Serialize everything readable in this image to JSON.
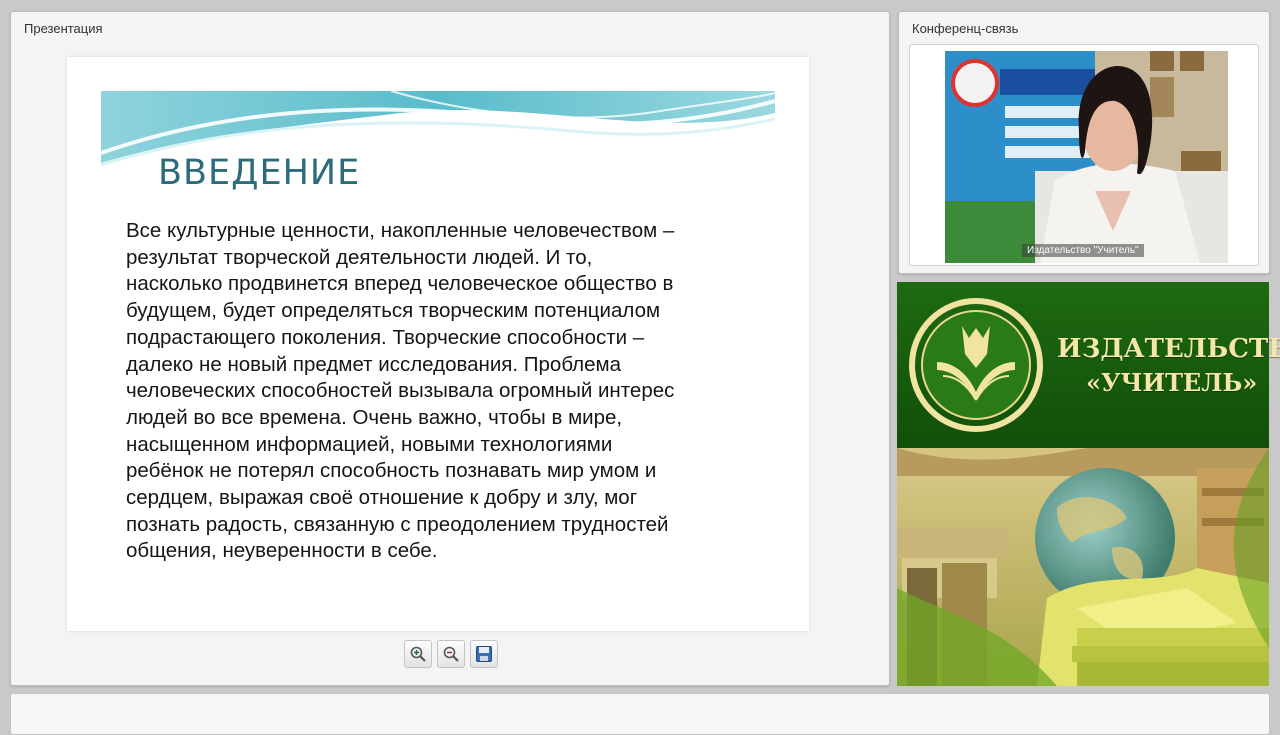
{
  "presentation": {
    "title": "Презентация",
    "slide": {
      "heading": "ВВЕДЕНИЕ",
      "lines": [
        "Все культурные ценности, накопленные человечеством –",
        "результат творческой деятельности людей. И то,",
        "насколько продвинется вперед человеческое общество в",
        "будущем, будет определяться творческим потенциалом",
        "подрастающего поколения. Творческие способности –",
        "далеко не новый предмет исследования. Проблема",
        "человеческих способностей вызывала огромный интерес",
        "людей во все времена. Очень важно, чтобы в мире,",
        "насыщенном информацией, новыми технологиями",
        "ребёнок не потерял способность познавать мир умом и",
        "сердцем, выражая своё отношение к добру и злу, мог",
        "познать радость, связанную с преодолением трудностей",
        "общения, неуверенности в себе."
      ]
    },
    "toolbar": [
      {
        "icon": "zoom-in-icon"
      },
      {
        "icon": "zoom-out-icon"
      },
      {
        "icon": "save-icon"
      }
    ]
  },
  "conference": {
    "title": "Конференц-связь",
    "video_caption": "Издательство \"Учитель\""
  },
  "publisher": {
    "line1": "ИЗДАТЕЛЬСТВО",
    "line2": "«УЧИТЕЛЬ»"
  },
  "colors": {
    "heading": "#2b6b7a",
    "banner_green": "#1f6a12",
    "publisher_text": "#f4e7a7"
  }
}
